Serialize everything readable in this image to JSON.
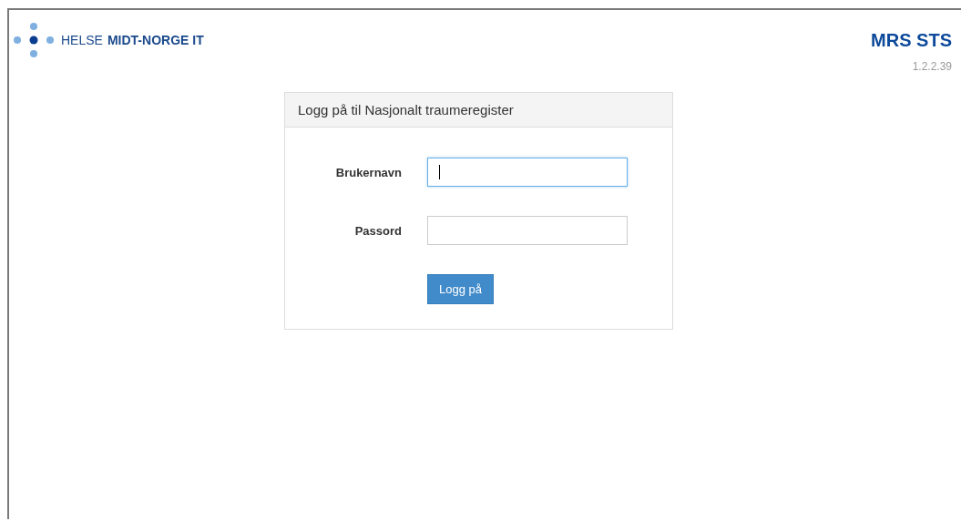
{
  "logo": {
    "text_light": "HELSE",
    "text_bold": "MIDT-NORGE IT"
  },
  "app": {
    "title": "MRS STS",
    "version": "1.2.2.39"
  },
  "login": {
    "heading": "Logg på til Nasjonalt traumeregister",
    "fields": [
      {
        "label": "Brukernavn",
        "focused": true
      },
      {
        "label": "Passord",
        "focused": false
      }
    ],
    "button": "Logg på"
  }
}
